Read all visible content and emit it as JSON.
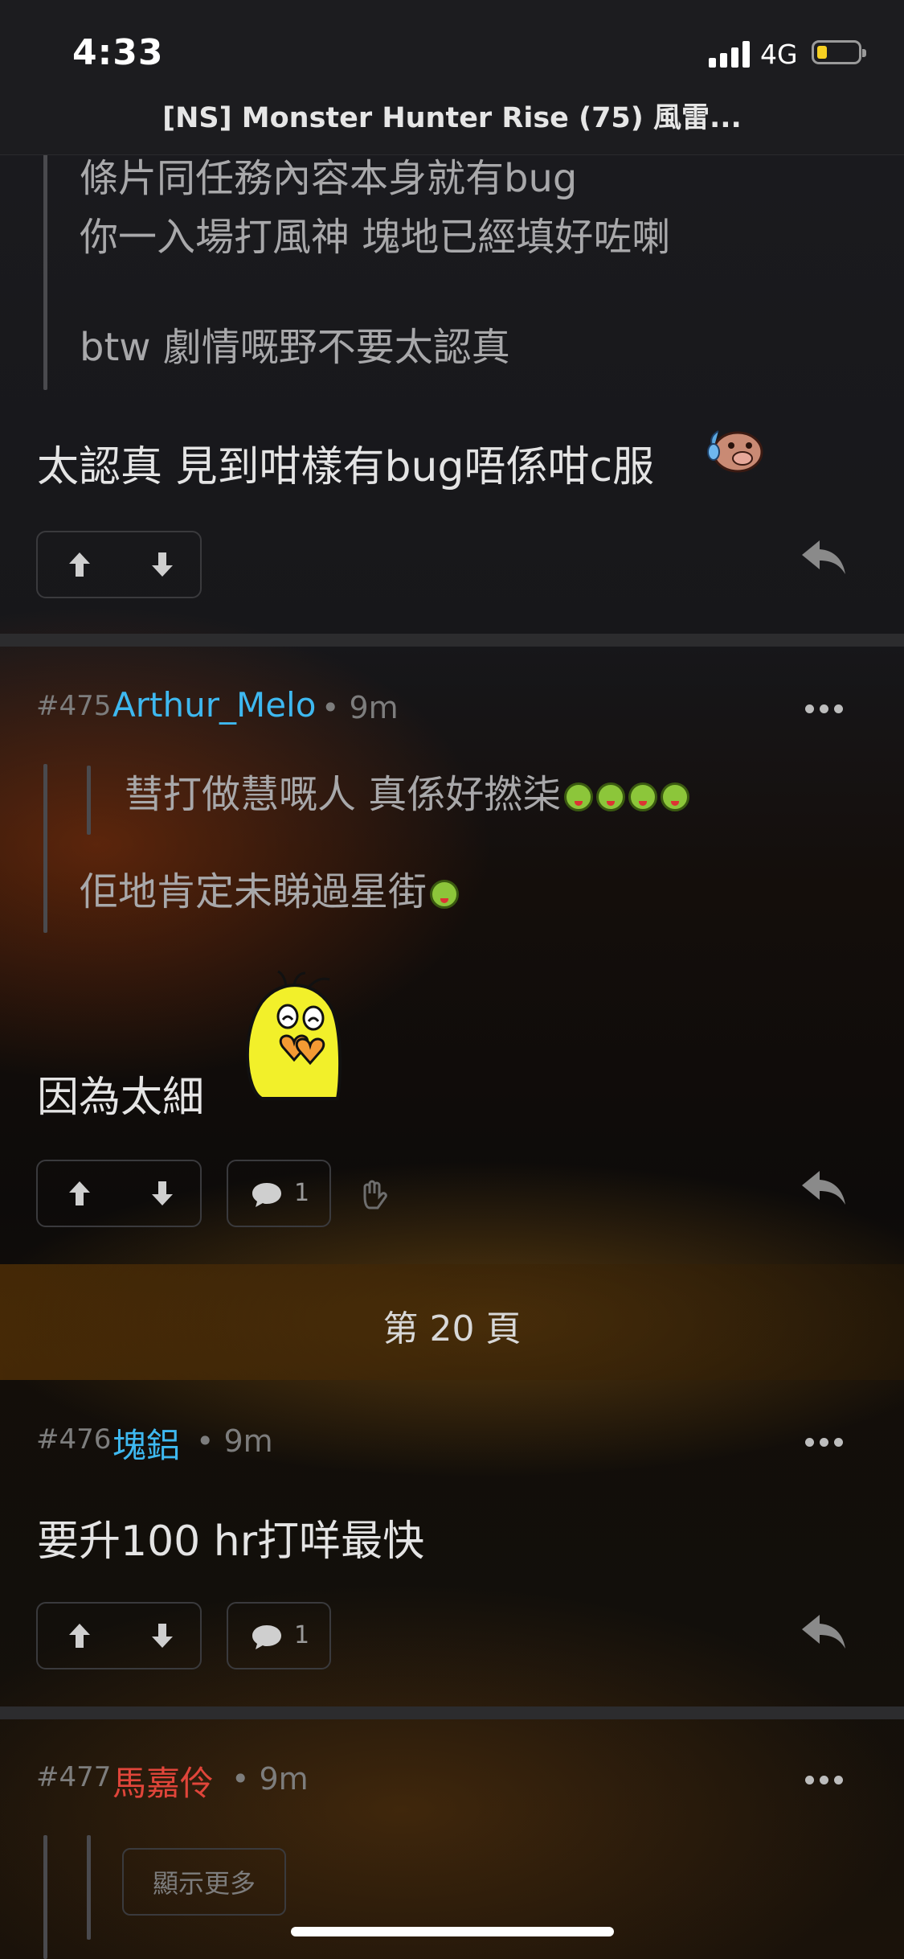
{
  "status_bar": {
    "time": "4:33",
    "network": "4G",
    "battery_percent": 15
  },
  "header": {
    "title": "[NS] Monster Hunter Rise (75) 風雷..."
  },
  "colors": {
    "accent_user": "#3eb8f0",
    "highlight_user": "#e0453a",
    "background": "#121214",
    "battery": "#f6d022"
  },
  "post_top": {
    "quote_lines": [
      "條片同任務內容本身就有bug",
      "你一入場打風神 塊地已經填好咗喇",
      "",
      "btw 劇情嘅野不要太認真"
    ],
    "body": "太認真 見到咁樣有bug唔係咁c服",
    "sticker": "sweating-pig-sticker"
  },
  "post_475": {
    "number": "#475",
    "username": "Arthur_Melo",
    "time": "• 9m",
    "nested_quote": "彗打做慧嘅人 真係好撚柒",
    "quote": "佢地肯定未睇過星街",
    "body": "因為太細",
    "sticker": "yellow-blob-heart-sticker",
    "comment_count": "1"
  },
  "page_divider": {
    "label": "第 20 頁"
  },
  "post_476": {
    "number": "#476",
    "username": "塊鋁",
    "time": "• 9m",
    "body": "要升100 hr打咩最快",
    "comment_count": "1"
  },
  "post_477": {
    "number": "#477",
    "username": "馬嘉伶",
    "time": "• 9m",
    "show_more_label": "顯示更多"
  },
  "icons": [
    "upvote-arrow-icon",
    "downvote-arrow-icon",
    "comment-icon",
    "reply-icon",
    "more-dots-icon",
    "hand-icon",
    "signal-icon",
    "battery-icon"
  ]
}
